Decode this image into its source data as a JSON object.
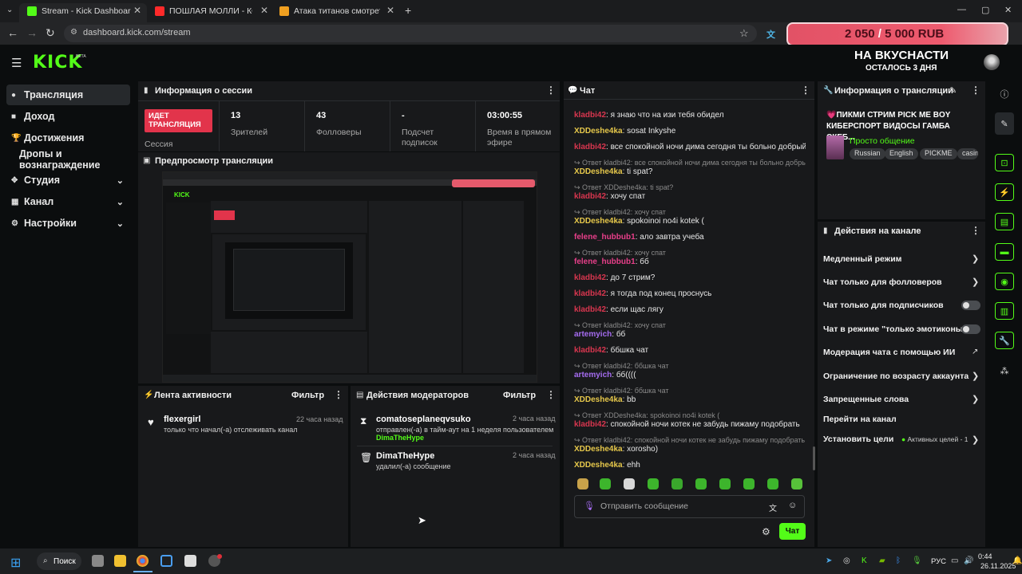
{
  "browser": {
    "tabs": [
      {
        "title": "Stream - Kick Dashboard",
        "fav": "#53fc18"
      },
      {
        "title": "ПОШЛАЯ МОЛЛИ - КОНТРАКТ",
        "fav": "#ff2a2a"
      },
      {
        "title": "Атака титанов смотреть онлайн",
        "fav": "#f0a020"
      }
    ],
    "new_tab": "+",
    "url": "dashboard.kick.com/stream",
    "window_controls": [
      "—",
      "▢",
      "✕"
    ]
  },
  "donation_goal": {
    "current": "2 050",
    "separator": "/",
    "target": "5 000 RUB"
  },
  "header": {
    "logo": "KICK",
    "logo_badge": "BETA",
    "goal_title": "НА ВКУСНАСТИ",
    "goal_subtitle": "ОСТАЛОСЬ 3 ДНЯ"
  },
  "sidebar": {
    "items": [
      {
        "label": "Трансляция",
        "icon": "broadcast-icon"
      },
      {
        "label": "Доход",
        "icon": "revenue-icon"
      },
      {
        "label": "Достижения",
        "icon": "trophy-icon"
      },
      {
        "label": "Дропы и вознаграждение",
        "icon": ""
      },
      {
        "label": "Студия",
        "icon": "studio-icon"
      },
      {
        "label": "Канал",
        "icon": "channel-icon"
      },
      {
        "label": "Настройки",
        "icon": "gear-icon"
      }
    ]
  },
  "session": {
    "title": "Информация о сессии",
    "status_badge": "ИДЕТ ТРАНСЛЯЦИЯ",
    "status_label": "Сессия",
    "stats": [
      {
        "value": "13",
        "label": "Зрителей"
      },
      {
        "value": "43",
        "label": "Фолловеры"
      },
      {
        "value": "-",
        "label": "Подсчет подписок"
      },
      {
        "value": "03:00:55",
        "label": "Время в прямом эфире"
      }
    ]
  },
  "preview": {
    "title": "Предпросмотр трансляции"
  },
  "activity": {
    "title": "Лента активности",
    "filter": "Фильтр",
    "items": [
      {
        "user": "flexergirl",
        "text": "только что начал(-а) отслеживать канал",
        "time": "22 часа назад"
      }
    ]
  },
  "mod_actions": {
    "title": "Действия модераторов",
    "filter": "Фильтр",
    "items": [
      {
        "user": "comatoseplaneqvsuko",
        "text": "отправлен(-а) в тайм-аут на 1 неделя пользователем",
        "target": "DimaTheHype",
        "time": "2 часа назад"
      },
      {
        "user": "DimaTheHype",
        "text": "удалил(-а) сообщение",
        "time": "2 часа назад"
      }
    ]
  },
  "chat": {
    "title": "Чат",
    "messages": [
      {
        "type": "msg",
        "user": "kladbi42",
        "ucls": "u1",
        "text": "я знаю что на изи тебя обидел"
      },
      {
        "type": "msg",
        "user": "XDDeshe4ka",
        "ucls": "u2",
        "text": "sosat Inkyshe"
      },
      {
        "type": "msg",
        "user": "kladbi42",
        "ucls": "u1",
        "text": "все спокойной ночи дима сегодня ты больно добрый"
      },
      {
        "type": "reply",
        "text": "Ответ kladbi42: все спокойной ночи дима сегодня ты больно добрый"
      },
      {
        "type": "msg",
        "user": "XDDeshe4ka",
        "ucls": "u2",
        "text": "ti spat?"
      },
      {
        "type": "reply",
        "text": "Ответ XDDeshe4ka: ti spat?"
      },
      {
        "type": "msg",
        "user": "kladbi42",
        "ucls": "u1",
        "text": "хочу спат"
      },
      {
        "type": "reply",
        "text": "Ответ kladbi42: хочу спат"
      },
      {
        "type": "msg",
        "user": "XDDeshe4ka",
        "ucls": "u2",
        "text": "spokoinoi no4i kotek ("
      },
      {
        "type": "msg",
        "user": "felene_hubbub1",
        "ucls": "u3",
        "text": "ало завтра учеба"
      },
      {
        "type": "reply",
        "text": "Ответ kladbi42: хочу спат"
      },
      {
        "type": "msg",
        "user": "felene_hubbub1",
        "ucls": "u3",
        "text": "бб"
      },
      {
        "type": "msg",
        "user": "kladbi42",
        "ucls": "u1",
        "text": "до 7 стрим?"
      },
      {
        "type": "msg",
        "user": "kladbi42",
        "ucls": "u1",
        "text": "я тогда под конец проснусь"
      },
      {
        "type": "msg",
        "user": "kladbi42",
        "ucls": "u1",
        "text": "если щас лягу"
      },
      {
        "type": "reply",
        "text": "Ответ kladbi42: хочу спат"
      },
      {
        "type": "msg",
        "user": "artemyich",
        "ucls": "u4",
        "text": "бб"
      },
      {
        "type": "msg",
        "user": "kladbi42",
        "ucls": "u1",
        "text": "ббшка чат"
      },
      {
        "type": "reply",
        "text": "Ответ kladbi42: ббшка чат"
      },
      {
        "type": "msg",
        "user": "artemyich",
        "ucls": "u4",
        "text": "бб(((("
      },
      {
        "type": "reply",
        "text": "Ответ kladbi42: ббшка чат"
      },
      {
        "type": "msg",
        "user": "XDDeshe4ka",
        "ucls": "u2",
        "text": "bb"
      },
      {
        "type": "reply",
        "text": "Ответ XDDeshe4ka: spokoinoi no4i kotek ("
      },
      {
        "type": "msg",
        "user": "kladbi42",
        "ucls": "u1",
        "text": "спокойной ночи котек не забудь пижаму подобрать"
      },
      {
        "type": "reply",
        "text": "Ответ kladbi42: спокойной ночи котек не забудь пижаму подобрать"
      },
      {
        "type": "msg",
        "user": "XDDeshe4ka",
        "ucls": "u2",
        "text": "xorosho)"
      },
      {
        "type": "msg",
        "user": "XDDeshe4ka",
        "ucls": "u2",
        "text": "ehh"
      }
    ],
    "input_placeholder": "Отправить сообщение",
    "send_label": "Чат"
  },
  "stream_info": {
    "title": "Информация о трансляции",
    "stream_title": "💗ПИКМИ СТРИМ PICK ME BOY КИБЕРСПОРТ ВИДОСЫ ГАМБА СКЕБ...",
    "category": "Просто общение",
    "tags": [
      "Russian",
      "English",
      "PICKME",
      "casin"
    ]
  },
  "channel_actions": {
    "title": "Действия на канале",
    "items": [
      {
        "label": "Медленный режим",
        "control": "chevron"
      },
      {
        "label": "Чат только для фолловеров",
        "control": "chevron"
      },
      {
        "label": "Чат только для подписчиков",
        "control": "toggle"
      },
      {
        "label": "Чат в режиме \"только эмотиконы\"",
        "control": "toggle"
      },
      {
        "label": "Модерация чата с помощью ИИ",
        "control": "external"
      },
      {
        "label": "Ограничение по возрасту аккаунта",
        "control": "chevron"
      },
      {
        "label": "Запрещенные слова",
        "control": "chevron"
      },
      {
        "label": "Перейти на канал",
        "control": "none"
      },
      {
        "label": "Установить цели",
        "control": "chevron"
      }
    ],
    "active_goals": "Активных целей - 1"
  },
  "taskbar": {
    "search": "Поиск",
    "lang": "РУС",
    "time": "0:44",
    "date": "26.11.2025"
  }
}
